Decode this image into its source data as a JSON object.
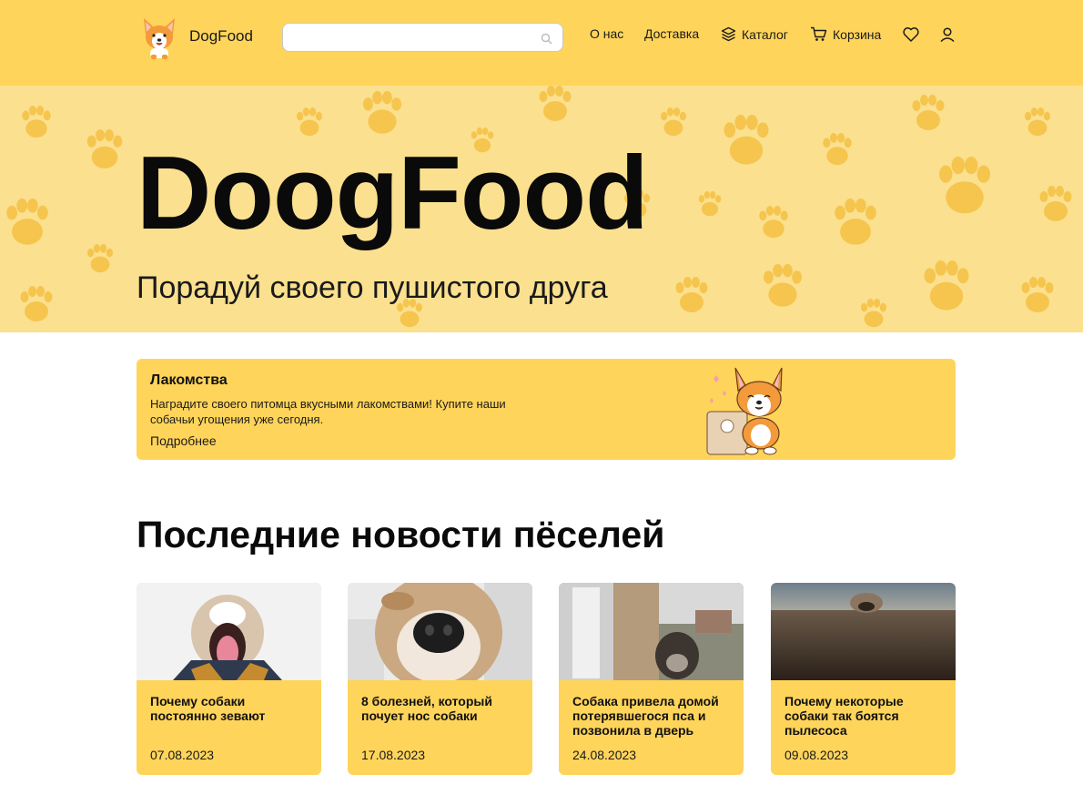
{
  "header": {
    "brand": "DogFood",
    "search_placeholder": "",
    "nav": [
      "О нас",
      "Доставка",
      "Каталог",
      "Корзина"
    ],
    "icons": [
      "corgi-logo",
      "search-icon",
      "catalog-icon",
      "cart-icon",
      "heart-icon",
      "user-icon"
    ]
  },
  "hero": {
    "title": "DoogFood",
    "subtitle": "Порадуй своего пушистого друга"
  },
  "promo": {
    "title": "Лакомства",
    "text": "Наградите своего питомца вкусными лакомствами! Купите наши собачьи угощения уже сегодня.",
    "link": "Подробнее"
  },
  "news": {
    "title": "Последние новости пёселей",
    "items": [
      {
        "title": "Почему собаки постоянно зевают",
        "date": "07.08.2023"
      },
      {
        "title": "8 болезней, который почует нос собаки",
        "date": "17.08.2023"
      },
      {
        "title": "Собака привела домой потерявшегося пса и позвонила в дверь",
        "date": "24.08.2023"
      },
      {
        "title": "Почему некоторые собаки так боятся пылесоса",
        "date": "09.08.2023"
      }
    ]
  },
  "colors": {
    "accent": "#ffd45a",
    "hero_bg": "#fbe08f",
    "paw": "#f5c54e"
  }
}
